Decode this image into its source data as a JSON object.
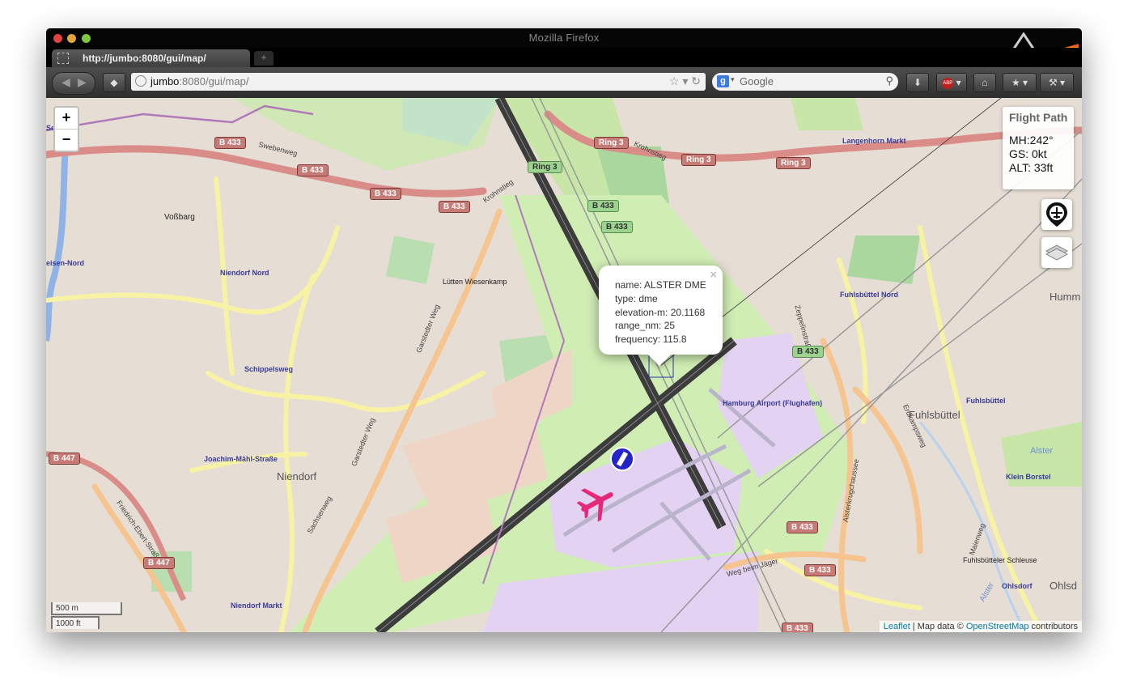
{
  "window": {
    "title": "Mozilla Firefox"
  },
  "tabs": [
    {
      "label": "http://jumbo:8080/gui/map/"
    }
  ],
  "newtab_label": "+",
  "urlbar": {
    "host": "jumbo",
    "rest": ":8080/gui/map/"
  },
  "search": {
    "engine": "g",
    "placeholder": "Google"
  },
  "toolbar": {
    "abp_label": "ABP"
  },
  "zoom": {
    "in": "+",
    "out": "−"
  },
  "flight": {
    "title": "Flight Path",
    "mh": "MH:242°",
    "gs": "GS: 0kt",
    "alt": "ALT: 33ft"
  },
  "popup": {
    "close": "×",
    "lines": [
      "name: ALSTER DME",
      "type: dme",
      "elevation-m: 20.1168",
      "range_nm: 25",
      "frequency: 115.8"
    ]
  },
  "scale": {
    "metric": "500 m",
    "imperial": "1000 ft"
  },
  "attribution": {
    "leaflet": "Leaflet",
    "sep": " | Map data © ",
    "osm": "OpenStreetMap",
    "tail": " contributors"
  },
  "map_labels": {
    "niendorf_nord": "Niendorf Nord",
    "schippelsweg": "Schippelsweg",
    "joachim": "Joachim-Mähl-Straße",
    "niendorf_markt": "Niendorf Markt",
    "niendorf": "Niendorf",
    "vossbarg": "Voßbarg",
    "luetten": "Lütten Wiesenkamp",
    "airport": "Hamburg Airport (Flughafen)",
    "fuhls_nord": "Fuhlsbüttel Nord",
    "fuhls": "Fuhlsbüttel",
    "fuhls_place": "Fuhlsbüttel",
    "klein_borstel": "Klein Borstel",
    "ohlsdorf": "Ohlsdorf",
    "ohlsd_place": "Ohlsd",
    "langenhorn": "Langenhorn Markt",
    "humm": "Humm",
    "schleuse": "Fuhlsbütteler Schleuse",
    "swebenweg": "Swebenweg",
    "krohnstieg": "Krohnstieg",
    "krohnstieg2": "Krohnstieg",
    "garstedter": "Garstedter Weg",
    "garstedter2": "Garstedter Weg",
    "sachsenweg": "Sachsenweg",
    "weg_beim_jaeger": "Weg beim Jäger",
    "friedrich": "Friedrich-Ebert-Straße",
    "alsterkrug": "Alsterkrugchaussee",
    "erdkamps": "Erdkampsweg",
    "zeppelin": "Zeppelinstraße",
    "maienweg": "Maienweg",
    "nord_left": "Sen-Nord",
    "eisen_nord": "eisen-Nord",
    "alster": "Alster",
    "alster2": "Alster"
  },
  "shields": {
    "b433_a": "B 433",
    "b433_b": "B 433",
    "b433_c": "B 433",
    "b433_d": "B 433",
    "ring3_a": "Ring 3",
    "ring3_b": "Ring 3",
    "ring3_c": "Ring 3",
    "ring3_d": "Ring 3",
    "b433_e": "B 433",
    "b433_f": "B 433",
    "b433_g": "B 433",
    "b433_h": "B 433",
    "b433_i": "B 433",
    "b433_j": "B 433",
    "b447_a": "B 447",
    "b447_b": "B 447"
  }
}
